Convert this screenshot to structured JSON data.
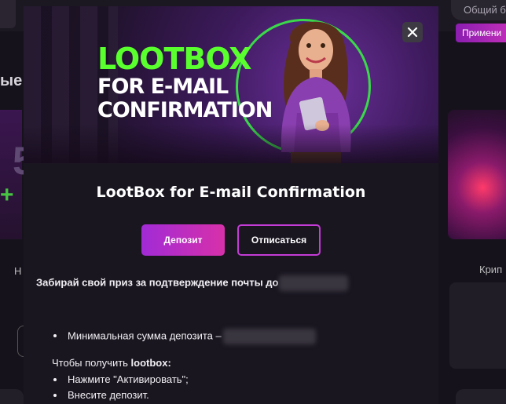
{
  "background": {
    "search_placeholder": "Общий б",
    "apply_button": "Примени",
    "heading_fragment": "ые",
    "left_card_number": "5",
    "left_card_letter": "Н",
    "right_card_label": "Крип"
  },
  "modal": {
    "banner": {
      "title_line1": "LOOTBOX",
      "title_line2": "FOR E-MAIL",
      "title_line3": "CONFIRMATION"
    },
    "close_label": "×",
    "title": "LootBox for E-mail Confirmation",
    "deposit_button": "Депозит",
    "unsubscribe_button": "Отписаться",
    "intro_text": "Забирай свой приз за подтверждение почты до",
    "min_deposit_text": "Минимальная сумма депозита –",
    "how_to_text": "Чтобы получить ",
    "how_to_bold": "lootbox:",
    "steps": [
      "Нажмите \"Активировать\";",
      "Внесите депозит."
    ]
  },
  "colors": {
    "accent_green": "#5aff2e",
    "accent_magenta": "#d730a9",
    "accent_purple": "#a12bd6",
    "modal_bg": "#1a1620"
  }
}
